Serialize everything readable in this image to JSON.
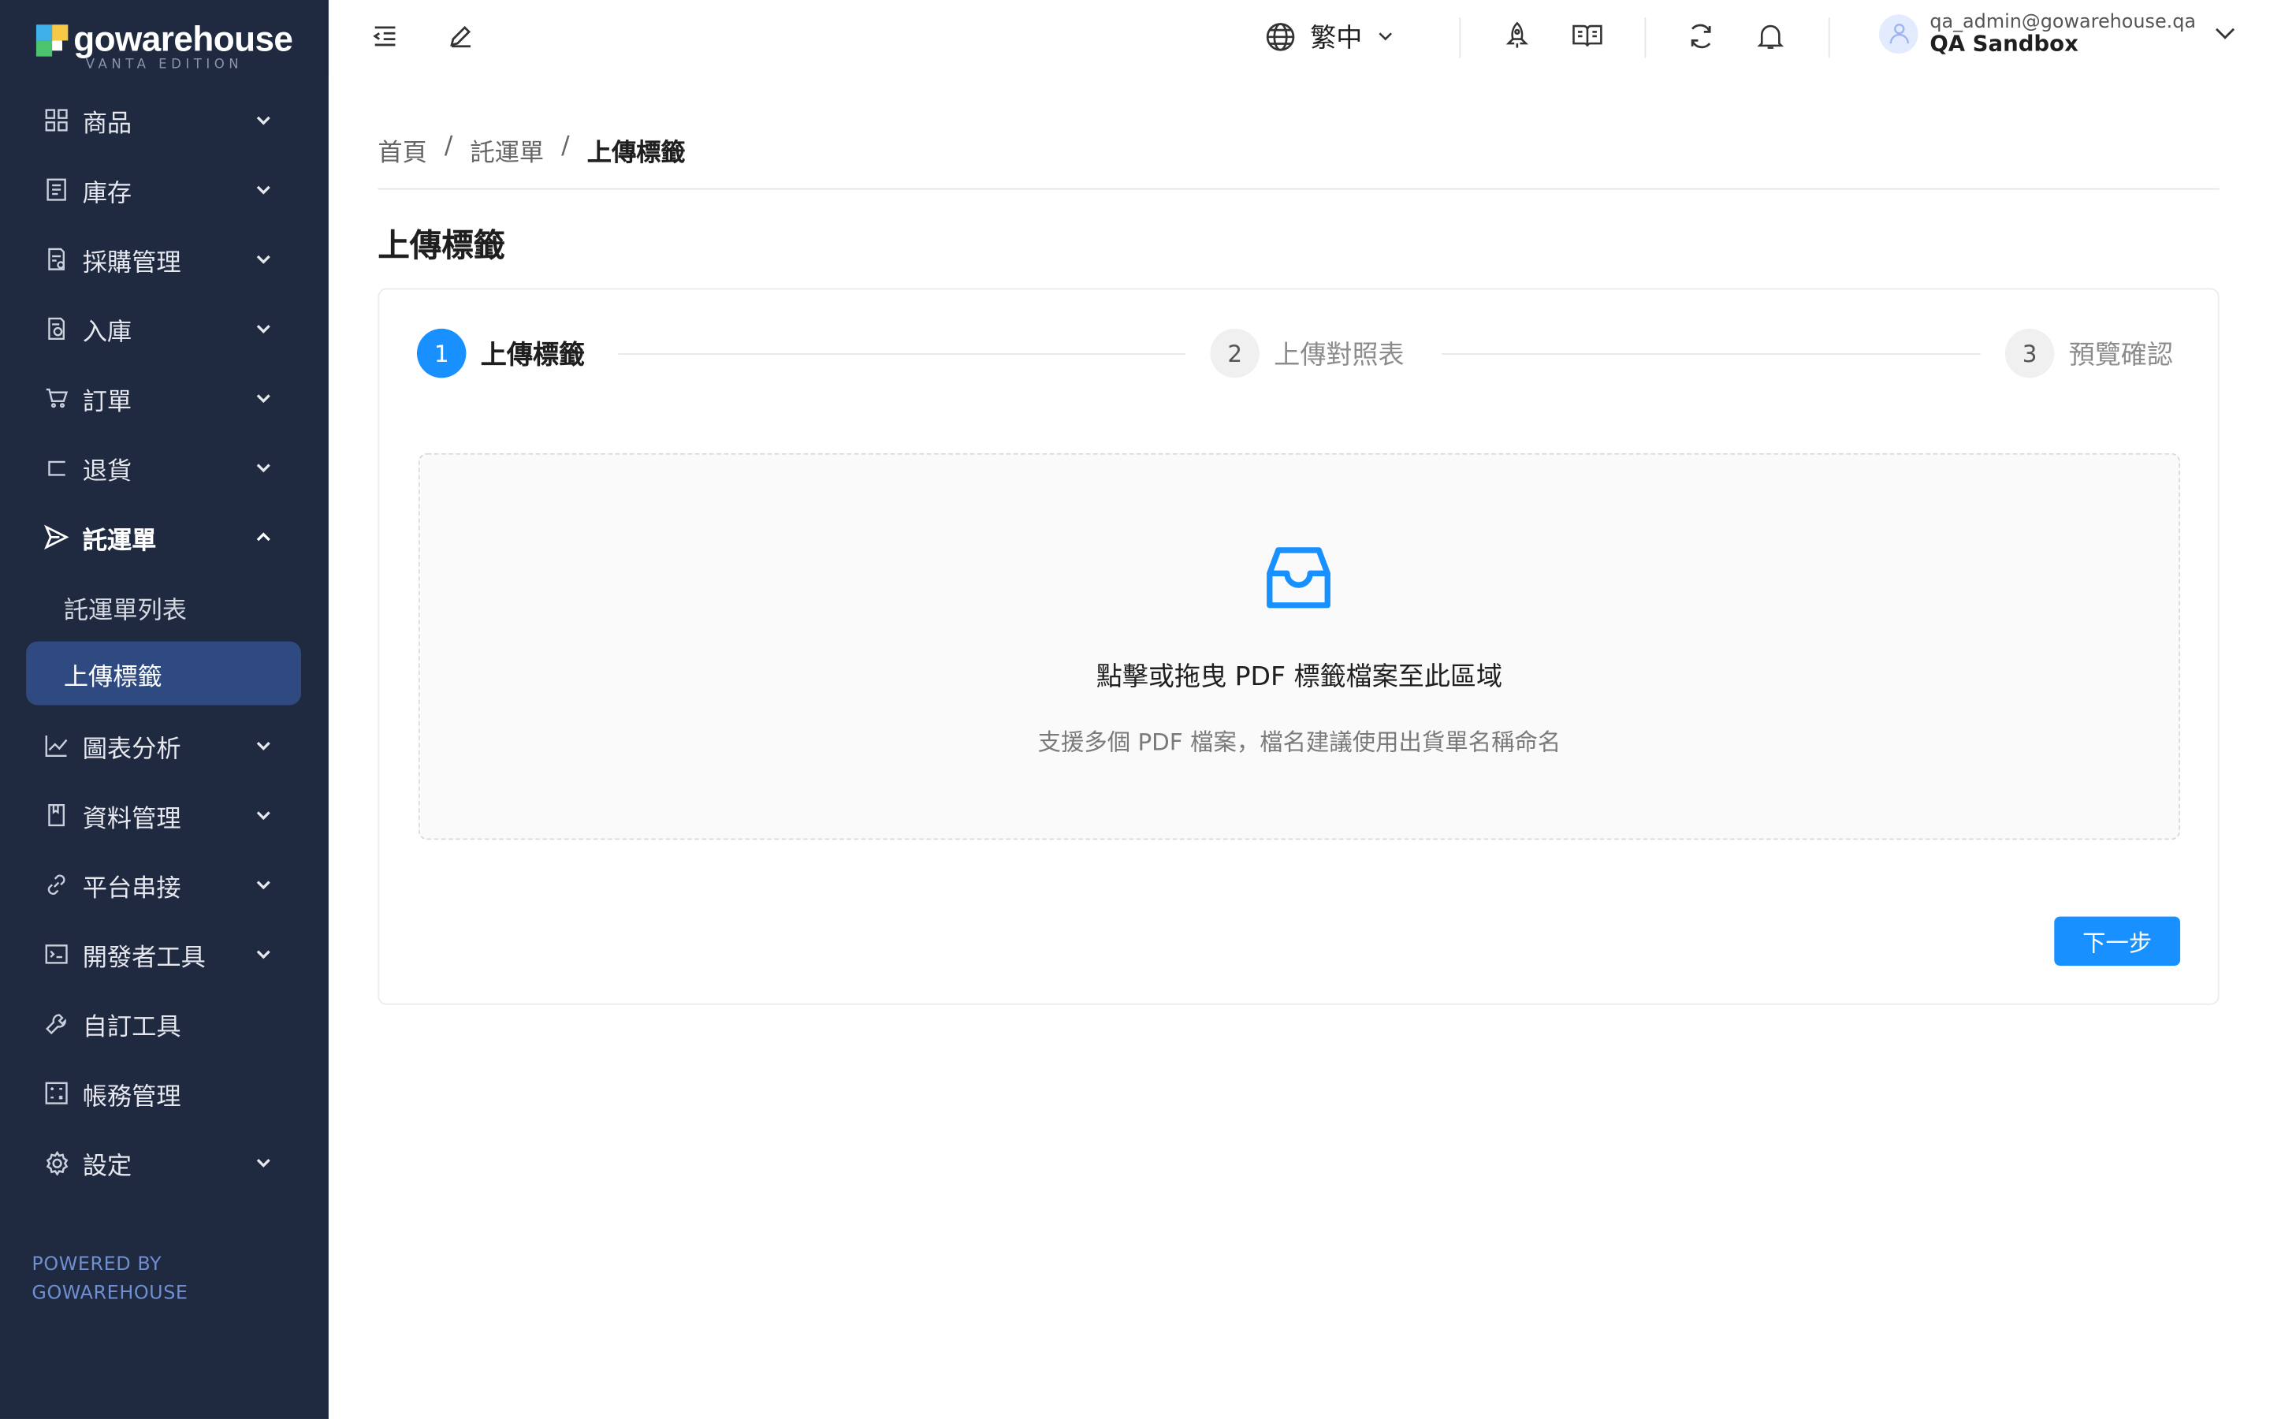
{
  "brand": {
    "name": "gowarehouse",
    "edition": "VANTA EDITION"
  },
  "sidebar": {
    "items": [
      {
        "label": "商品",
        "icon": "grid-icon"
      },
      {
        "label": "庫存",
        "icon": "inventory-icon"
      },
      {
        "label": "採購管理",
        "icon": "purchase-icon"
      },
      {
        "label": "入庫",
        "icon": "inbound-icon"
      },
      {
        "label": "訂單",
        "icon": "cart-icon"
      },
      {
        "label": "退貨",
        "icon": "return-icon"
      },
      {
        "label": "託運單",
        "icon": "send-icon",
        "open": true,
        "children": [
          {
            "label": "託運單列表"
          },
          {
            "label": "上傳標籤",
            "active": true
          }
        ]
      },
      {
        "label": "圖表分析",
        "icon": "line-chart-icon"
      },
      {
        "label": "資料管理",
        "icon": "book-icon"
      },
      {
        "label": "平台串接",
        "icon": "link-icon"
      },
      {
        "label": "開發者工具",
        "icon": "terminal-icon"
      },
      {
        "label": "自訂工具",
        "icon": "tool-icon"
      },
      {
        "label": "帳務管理",
        "icon": "billing-icon"
      },
      {
        "label": "設定",
        "icon": "gear-icon"
      }
    ],
    "powered_by_line1": "POWERED BY",
    "powered_by_line2": "GOWAREHOUSE"
  },
  "header": {
    "language": "繁中",
    "user_email": "qa_admin@gowarehouse.qa",
    "user_name": "QA Sandbox"
  },
  "breadcrumb": {
    "home": "首頁",
    "section": "託運單",
    "current": "上傳標籤",
    "separator": "/"
  },
  "page": {
    "title": "上傳標籤"
  },
  "steps": [
    {
      "num": "1",
      "label": "上傳標籤",
      "status": "active"
    },
    {
      "num": "2",
      "label": "上傳對照表",
      "status": "wait"
    },
    {
      "num": "3",
      "label": "預覽確認",
      "status": "wait"
    }
  ],
  "upload": {
    "title": "點擊或拖曳 PDF 標籤檔案至此區域",
    "hint": "支援多個 PDF 檔案，檔名建議使用出貨單名稱命名"
  },
  "actions": {
    "next_label": "下一步"
  },
  "colors": {
    "sidebar_bg": "#1f2940",
    "active_item_bg": "#2e4a80",
    "primary": "#1890ff"
  }
}
